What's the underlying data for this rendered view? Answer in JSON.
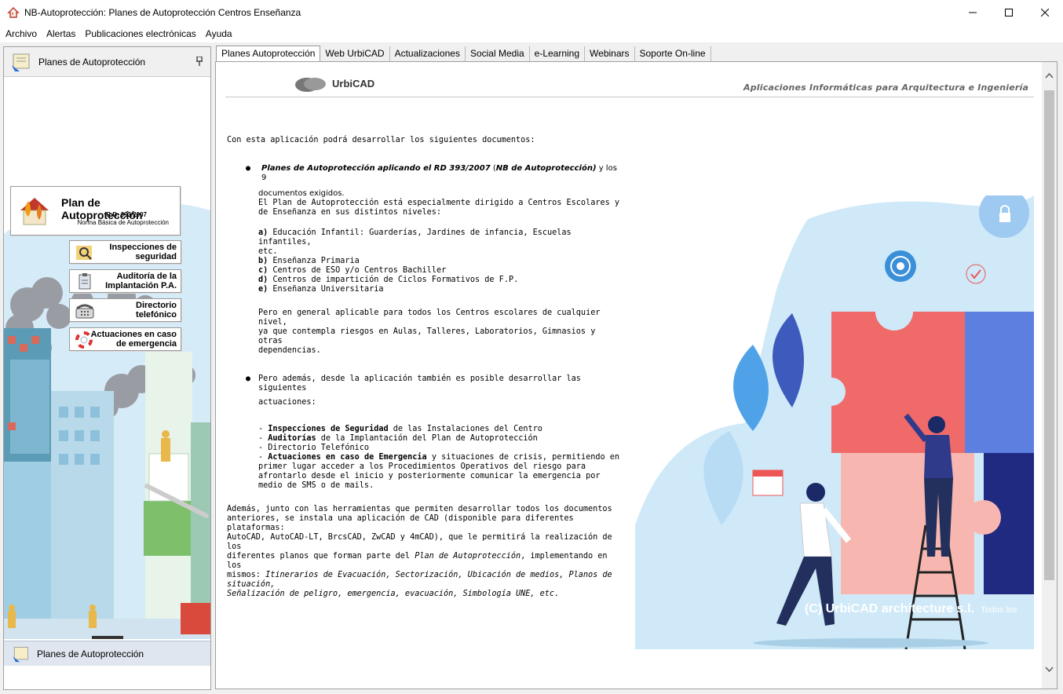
{
  "window": {
    "title": "NB-Autoprotección: Planes de Autoprotección Centros Enseñanza",
    "minimize": "—",
    "maximize": "☐",
    "close": "✕"
  },
  "menu": [
    "Archivo",
    "Alertas",
    "Publicaciones electrónicas",
    "Ayuda"
  ],
  "left_panel": {
    "header": "Planes de Autoprotección",
    "pin": "📌",
    "main_button": {
      "title": "Plan de Autoprotección",
      "sub1": "R.D. 393/2007",
      "sub2": "Norma Básica de Autoprotección"
    },
    "buttons": [
      {
        "label1": "Inspecciones de",
        "label2": "seguridad"
      },
      {
        "label1": "Auditoría de la",
        "label2": "Implantación P.A."
      },
      {
        "label1": "Directorio",
        "label2": "telefónico"
      },
      {
        "label1": "Actuaciones en caso",
        "label2": "de emergencia"
      }
    ],
    "footer": "Planes de Autoprotección"
  },
  "tabs": [
    "Planes Autoprotección",
    "Web UrbiCAD",
    "Actualizaciones",
    "Social Media",
    "e-Learning",
    "Webinars",
    "Soporte On-line"
  ],
  "content": {
    "logo": "UrbiCAD",
    "tagline": "Aplicaciones Informáticas para Arquitectura e Ingeniería",
    "intro": "Con esta aplicación podrá desarrollar los siguientes documentos:",
    "bullet1_bold": "Planes de Autoprotección aplicando el RD 393/2007",
    "bullet1_paren_open": " (",
    "bullet1_italic": "NB de Autoprotección)",
    "bullet1_rest": " y los 9",
    "bullet1_line2": "documentos exigidos.",
    "para1_l1": "El Plan de Autoprotección está especialmente dirigido a Centros Escolares y",
    "para1_l2": "de Enseñanza en sus distintos niveles:",
    "levels": [
      {
        "key": "a)",
        "text": " Educación Infantil: Guarderías, Jardines de infancia, Escuelas infantiles,"
      },
      {
        "key": "",
        "text": "etc."
      },
      {
        "key": "b)",
        "text": " Enseñanza Primaria"
      },
      {
        "key": "c)",
        "text": " Centros de ESO y/o Centros Bachiller"
      },
      {
        "key": "d)",
        "text": " Centros de impartición de Ciclos Formativos de F.P."
      },
      {
        "key": "e)",
        "text": " Enseñanza Universitaria"
      }
    ],
    "para2_l1": "Pero en general aplicable para todos los Centros escolares de cualquier nivel,",
    "para2_l2": "ya que contempla riesgos en Aulas, Talleres, Laboratorios, Gimnasios y otras",
    "para2_l3": "dependencias.",
    "bullet2_l1": "Pero además, desde la aplicación también es posible desarrollar las siguientes",
    "bullet2_l2": "actuaciones:",
    "actions": {
      "a1_bold": "Inspecciones de Seguridad",
      "a1_rest": " de las Instalaciones del Centro",
      "a2_bold": "Auditorías",
      "a2_rest": " de la Implantación del Plan de Autoprotección",
      "a3": "- Directorio Telefónico",
      "a4_bold": "Actuaciones en caso de Emergencia",
      "a4_rest": " y situaciones de crisis, permitiendo en",
      "a4_l2": "primer lugar acceder a los Procedimientos Operativos del riesgo para",
      "a4_l3": "afrontarlo desde el inicio y posteriormente comunicar la emergencia por",
      "a4_l4": "medio de SMS o de mails."
    },
    "final": {
      "l1": "Además, junto con las herramientas que permiten desarrollar todos los documentos",
      "l2": "anteriores, se instala una aplicación de CAD (disponible para diferentes plataformas:",
      "l3": "AutoCAD, AutoCAD-LT, BrcsCAD, ZwCAD y 4mCAD), que le permitirá la realización de los",
      "l4_a": "diferentes planos que forman parte del ",
      "l4_i": "Plan de Autoprotección",
      "l4_b": ", implementando en los",
      "l5_a": "mismos: ",
      "l5_i": "Itinerarios de Evacuación, Sectorización, Ubicación de medios, Planos de situación,",
      "l6_i": "Señalización de peligro, emergencia, evacuación, Simbología UNE, etc."
    },
    "copyright": "(C) UrbiCAD architecture s.l.",
    "copyright_small": "Todos los"
  },
  "colors": {
    "accent": "#0078d7",
    "puzzle_red": "#f06a6a",
    "puzzle_pink": "#f7b7b0",
    "puzzle_blue": "#5c7fe0",
    "puzzle_navy": "#1f2a80",
    "sky": "#cfe9f8"
  }
}
